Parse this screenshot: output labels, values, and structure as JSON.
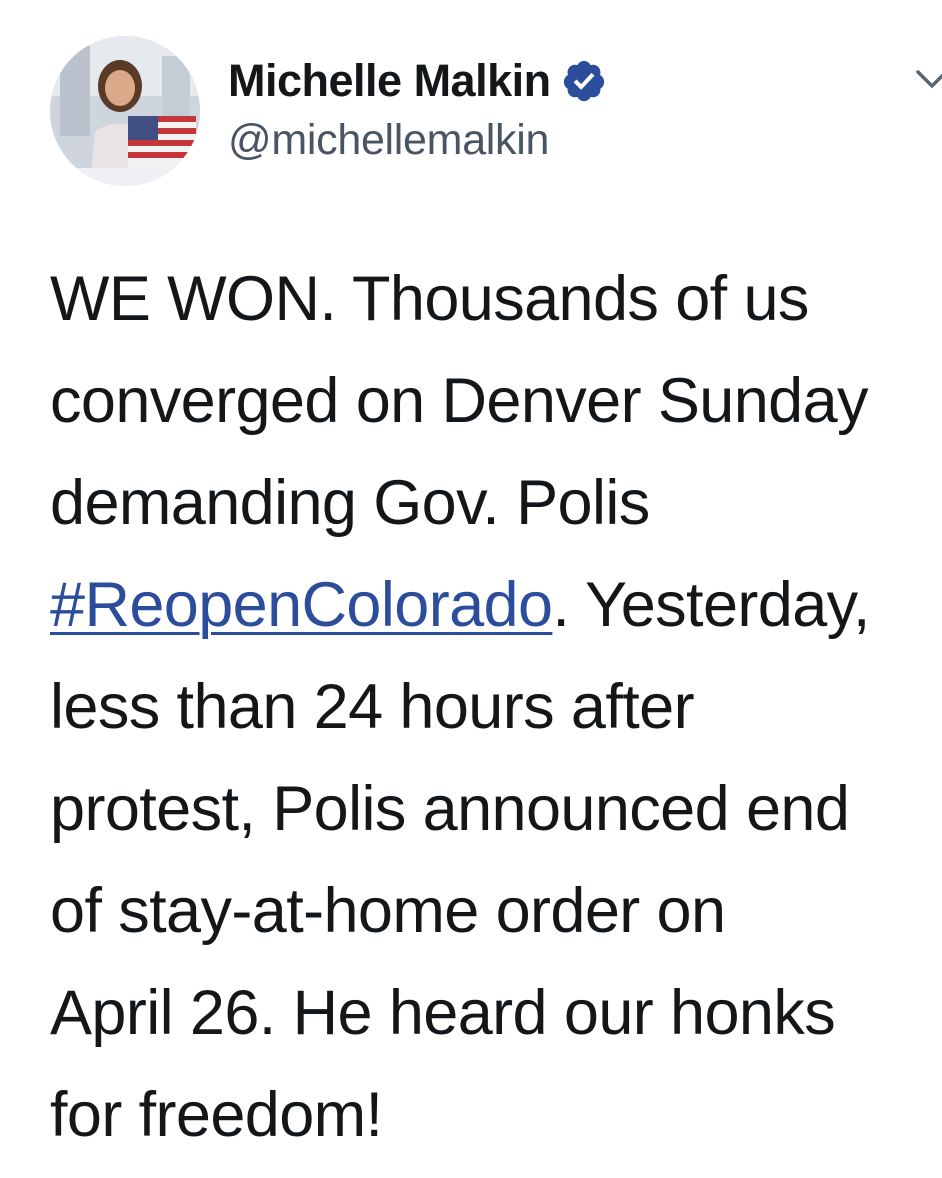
{
  "author": {
    "display_name": "Michelle Malkin",
    "handle": "@michellemalkin",
    "verified": true
  },
  "tweet": {
    "lines": [
      "WE WON. Thousands of us",
      "converged on Denver Sunday",
      "demanding Gov. Polis"
    ],
    "hashtag": "#ReopenColorado",
    "after_hashtag": ". Yesterday,",
    "lines_after": [
      "less than 24 hours after",
      "protest, Polis announced end",
      "of stay-at-home order on",
      "April 26. He heard our honks",
      "for freedom!"
    ]
  },
  "colors": {
    "text": "#14171a",
    "handle": "#4a5563",
    "hashtag_link": "#2b4d9c",
    "verified_badge": "#2b4d9c"
  },
  "icons": {
    "verified": "verified-badge-icon",
    "menu": "chevron-down-icon"
  }
}
